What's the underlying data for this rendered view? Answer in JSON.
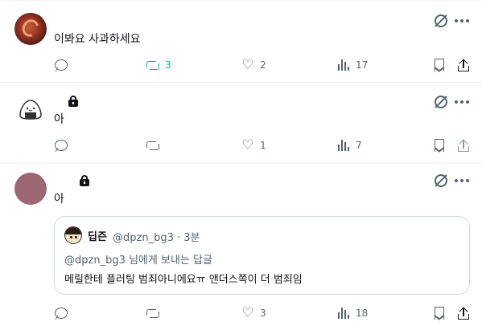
{
  "posts": [
    {
      "text": "이봐요 사과하세요",
      "reply_count": "",
      "retweet_count": "3",
      "like_count": "2",
      "view_count": "17",
      "retweeted": true
    },
    {
      "text": "아",
      "reply_count": "",
      "retweet_count": "",
      "like_count": "1",
      "view_count": "7",
      "retweeted": false
    },
    {
      "text": "아",
      "reply_count": "",
      "retweet_count": "",
      "like_count": "3",
      "view_count": "18",
      "retweeted": false,
      "quote": {
        "name": "딥즌",
        "handle_time": "@dpzn_bg3 · 3분",
        "reply_to": "@dpzn_bg3 님에게 보내는 답글",
        "text": "메릴한테 플러팅 범죄아니에요ㅠ 앤더스쪽이 더 범죄임"
      }
    }
  ],
  "colors": {
    "retweet_active": "#00ba7c",
    "icon_grey": "#536471",
    "border": "#eff3f4"
  }
}
